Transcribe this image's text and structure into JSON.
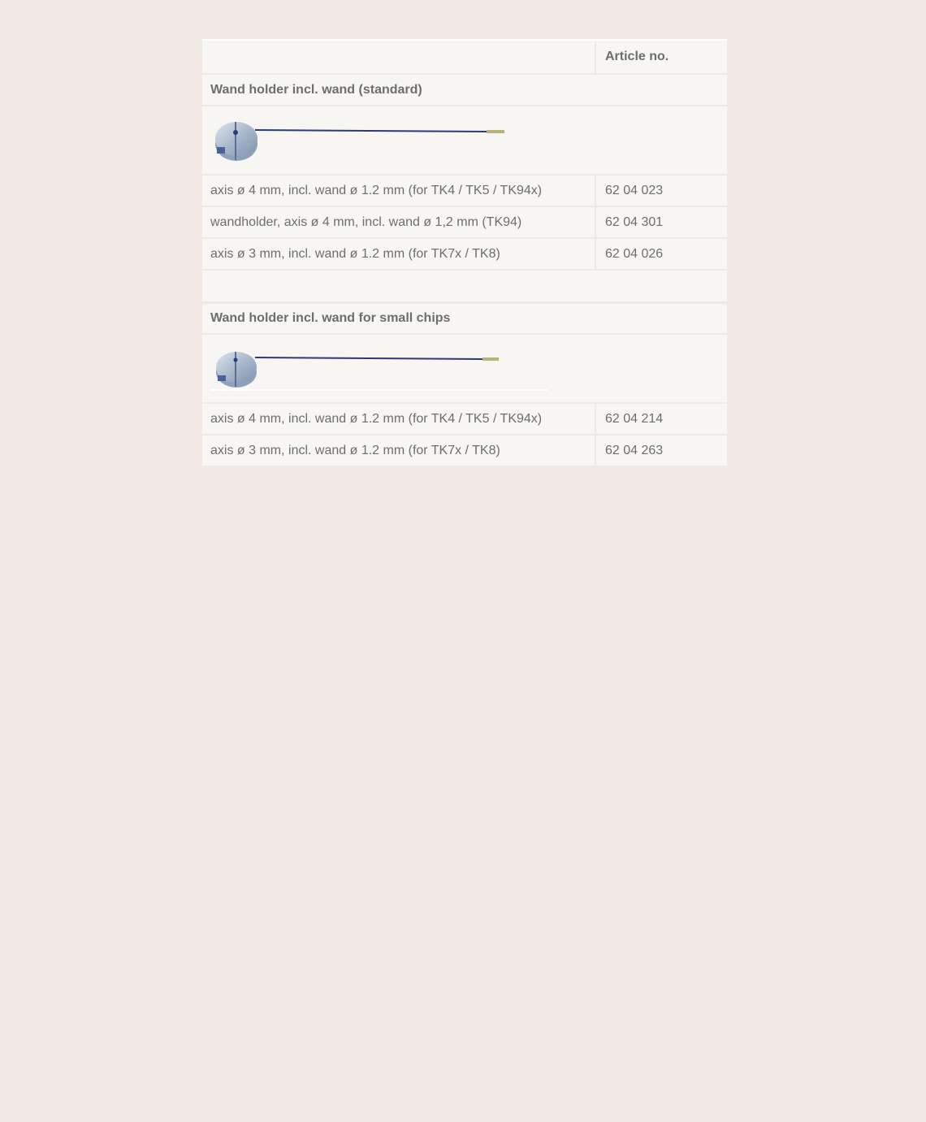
{
  "table": {
    "header": {
      "col1": "",
      "col2": "Article no."
    },
    "sections": [
      {
        "title": "Wand holder incl. wand (standard)",
        "image_icon": "wand-holder-image",
        "rows": [
          {
            "description": "axis ø 4 mm, incl. wand ø 1.2 mm (for TK4 / TK5 / TK94x)",
            "article": "62 04 023"
          },
          {
            "description": "wandholder, axis ø 4 mm, incl. wand ø 1,2 mm (TK94)",
            "article": "62 04 301"
          },
          {
            "description": "axis ø 3 mm, incl. wand ø 1.2 mm (for TK7x / TK8)",
            "article": "62 04 026"
          }
        ]
      },
      {
        "title": "Wand holder incl. wand for small chips",
        "image_icon": "wand-holder-small-image",
        "rows": [
          {
            "description": "axis ø 4 mm, incl. wand ø 1.2 mm (for TK4 / TK5 / TK94x)",
            "article": "62 04 214"
          },
          {
            "description": "axis ø 3 mm, incl. wand ø 1.2 mm (for TK7x / TK8)",
            "article": "62 04 263"
          }
        ]
      }
    ]
  },
  "colors": {
    "page_background": "#f1e9e3",
    "table_background": "#f8f6f3",
    "text": "#6e6e6e",
    "wand": "#2b3a7a",
    "holder": "#a9b8cc"
  }
}
